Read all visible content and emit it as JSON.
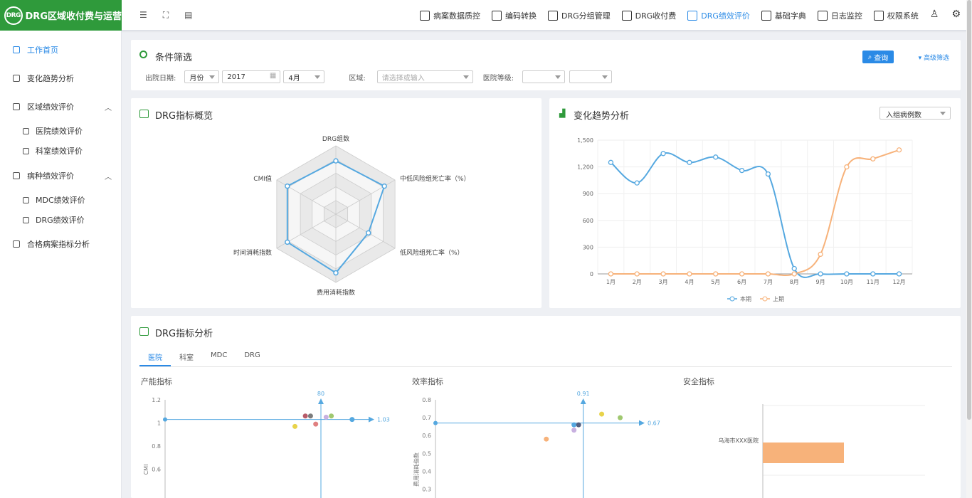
{
  "brand": {
    "logo_text": "DRG",
    "title": "DRG区域收付费与运营"
  },
  "toolbar": {
    "icons": [
      "menu-icon",
      "fullscreen-icon",
      "document-icon"
    ]
  },
  "nav": [
    {
      "label": "病案数据质控",
      "icon": "monitor-icon"
    },
    {
      "label": "编码转换",
      "icon": "code-icon"
    },
    {
      "label": "DRG分组管理",
      "icon": "group-icon"
    },
    {
      "label": "DRG收付费",
      "icon": "payment-icon"
    },
    {
      "label": "DRG绩效评价",
      "icon": "chart-icon",
      "active": true
    },
    {
      "label": "基础字典",
      "icon": "book-icon"
    },
    {
      "label": "日志监控",
      "icon": "log-icon"
    },
    {
      "label": "权限系统",
      "icon": "shield-icon"
    }
  ],
  "sidebar": [
    {
      "label": "工作首页",
      "active": true
    },
    {
      "label": "变化趋势分析"
    },
    {
      "label": "区域绩效评价",
      "expanded": true
    },
    {
      "label": "医院绩效评价",
      "sub": true
    },
    {
      "label": "科室绩效评价",
      "sub": true
    },
    {
      "label": "病种绩效评价",
      "expanded": true
    },
    {
      "label": "MDC绩效评价",
      "sub": true
    },
    {
      "label": "DRG绩效评价",
      "sub": true
    },
    {
      "label": "合格病案指标分析"
    }
  ],
  "filter": {
    "title": "条件筛选",
    "discharge_label": "出院日期:",
    "period": "月份",
    "year": "2017",
    "month": "4月",
    "region_label": "区域:",
    "region_placeholder": "请选择或输入",
    "level_label": "医院等级:",
    "query": "查询",
    "advanced": "高级筛选"
  },
  "radar": {
    "title": "DRG指标概览",
    "axes": [
      "DRG组数",
      "中低风险组死亡率（%）",
      "低风险组死亡率（%）",
      "费用消耗指数",
      "时间消耗指数",
      "CMI值"
    ],
    "values": [
      0.78,
      0.82,
      0.55,
      0.86,
      0.82,
      0.82
    ]
  },
  "trend": {
    "title": "变化趋势分析",
    "selector": "入组病例数",
    "legend": [
      "本期",
      "上期"
    ]
  },
  "chart_data": [
    {
      "type": "line",
      "categories": [
        "1月",
        "2月",
        "3月",
        "4月",
        "5月",
        "6月",
        "7月",
        "8月",
        "9月",
        "10月",
        "11月",
        "12月"
      ],
      "ylim": [
        0,
        1500
      ],
      "yticks": [
        "0",
        "300",
        "600",
        "900",
        "1,200",
        "1,500"
      ],
      "series": [
        {
          "name": "本期",
          "color": "#55a8e0",
          "values": [
            1250,
            1020,
            1350,
            1250,
            1310,
            1160,
            1120,
            60,
            0,
            0,
            0,
            0
          ]
        },
        {
          "name": "上期",
          "color": "#f7b27a",
          "values": [
            0,
            0,
            0,
            0,
            0,
            0,
            0,
            0,
            220,
            1200,
            1290,
            1390
          ]
        }
      ]
    },
    {
      "type": "scatter",
      "title": "产能指标",
      "ylabel": "CMI",
      "yticks": [
        "1.2",
        "1",
        "0.8",
        "0.6"
      ],
      "ref_x": "80",
      "ref_y": "1.03",
      "points": [
        {
          "x": 75,
          "y": 0.97,
          "color": "#e8d34a"
        },
        {
          "x": 77,
          "y": 1.06,
          "color": "#b85c6a"
        },
        {
          "x": 78,
          "y": 1.06,
          "color": "#7c7c7c"
        },
        {
          "x": 79,
          "y": 0.99,
          "color": "#e08080"
        },
        {
          "x": 81,
          "y": 1.05,
          "color": "#c8b0e0"
        },
        {
          "x": 82,
          "y": 1.06,
          "color": "#a0c870"
        },
        {
          "x": 86,
          "y": 1.03,
          "color": "#55a8e0"
        }
      ]
    },
    {
      "type": "scatter",
      "title": "效率指标",
      "ylabel": "费用消耗指数",
      "yticks": [
        "0.8",
        "0.7",
        "0.6",
        "0.5",
        "0.4",
        "0.3"
      ],
      "ref_x": "0.91",
      "ref_y": "0.67",
      "points": [
        {
          "x": 0.87,
          "y": 0.58,
          "color": "#f7b27a"
        },
        {
          "x": 0.9,
          "y": 0.66,
          "color": "#55a8e0"
        },
        {
          "x": 0.9,
          "y": 0.63,
          "color": "#c8b0e0"
        },
        {
          "x": 0.905,
          "y": 0.66,
          "color": "#556080"
        },
        {
          "x": 0.93,
          "y": 0.72,
          "color": "#e8d34a"
        },
        {
          "x": 0.95,
          "y": 0.7,
          "color": "#a0c870"
        }
      ]
    },
    {
      "type": "bar",
      "title": "安全指标",
      "categories": [
        "乌海市XXX医院"
      ],
      "values": [
        1
      ]
    }
  ],
  "analysis": {
    "title": "DRG指标分析",
    "tabs": [
      "医院",
      "科室",
      "MDC",
      "DRG"
    ]
  }
}
